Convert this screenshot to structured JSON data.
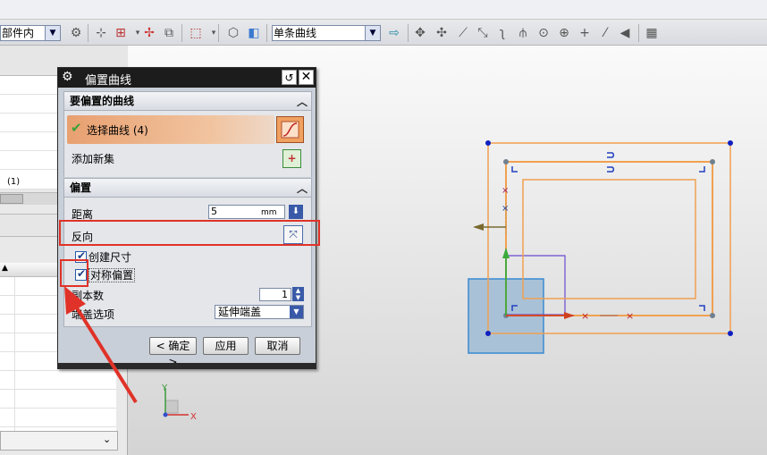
{
  "toolbar": {
    "scope_combo": "部件内",
    "curve_rule_combo": "单条曲线"
  },
  "dialog": {
    "title": "偏置曲线",
    "section_curve": {
      "header": "要偏置的曲线",
      "select_curve": "选择曲线 (4)",
      "add_new_set": "添加新集"
    },
    "section_offset": {
      "header": "偏置",
      "distance_label": "距离",
      "distance_value": "5",
      "distance_unit": "mm",
      "reverse_label": "反向",
      "create_dimension_label": "创建尺寸",
      "symmetric_offset_label": "对称偏置",
      "copies_label": "副本数",
      "copies_value": "1",
      "end_cap_label": "端盖选项",
      "end_cap_value": "延伸端盖"
    },
    "buttons": {
      "ok": "< 确定 >",
      "apply": "应用",
      "cancel": "取消"
    }
  },
  "left_pane": {
    "partial_label": "(1)"
  },
  "colors": {
    "highlight_red": "#e03228",
    "curve_orange": "#f0a050",
    "selection_bar": "#e8a070",
    "title_bar": "#1c1c1c"
  }
}
